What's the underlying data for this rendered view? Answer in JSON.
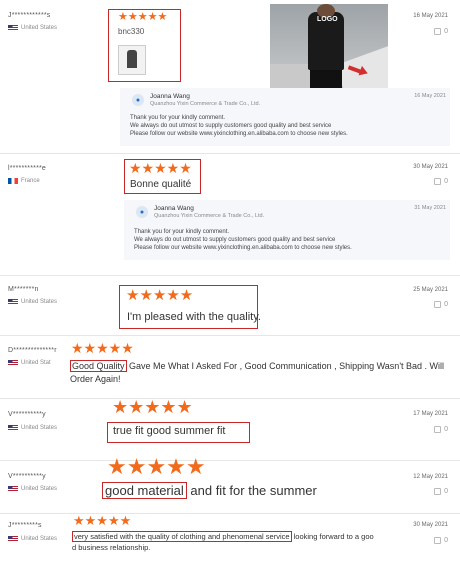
{
  "reviews": [
    {
      "user": "J************s",
      "country": "United States",
      "flag": "us",
      "date": "16 May 2021",
      "likes": "0",
      "stars": "★★★★★",
      "text": "bnc330",
      "reply": {
        "name": "Joanna Wang",
        "company": "Quanzhou Yixin Commerce & Trade Co., Ltd.",
        "date": "16 May 2021",
        "line1": "Thank you for your kindly comment.",
        "line2": "We always do out utmost to supply customers good quality and best service",
        "line3": "Please follow our website  www.yixinclothing.en.alibaba.com to choose new styles."
      },
      "photo_logo": "LOGO"
    },
    {
      "user": "l***********e",
      "country": "France",
      "flag": "fr",
      "date": "30 May 2021",
      "likes": "0",
      "stars": "★★★★★",
      "text": "Bonne qualité",
      "reply": {
        "name": "Joanna Wang",
        "company": "Quanzhou Yixin Commerce & Trade Co., Ltd.",
        "date": "31 May 2021",
        "line1": "Thank you for your kindly comment.",
        "line2": "We always do out utmost to supply customers good quality and best service",
        "line3": "Please follow our website  www.yixinclothing.en.alibaba.com to choose new styles."
      }
    },
    {
      "user": "M*******n",
      "country": "United States",
      "flag": "us",
      "date": "25 May 2021",
      "likes": "0",
      "stars": "★★★★★",
      "text": "I'm pleased with the quality."
    },
    {
      "user": "D**************r",
      "country": "United Stat",
      "flag": "us",
      "stars": "★★★★★",
      "text_box": "Good Quality",
      "text_rest": " Gave Me What I Asked For , Good Communication , Shipping Wasn't Bad . Will",
      "text_line2": "Order Again!"
    },
    {
      "user": "V**********y",
      "country": "United States",
      "flag": "us",
      "date": "17 May 2021",
      "likes": "0",
      "stars": "★★★★★",
      "text": "true fit good summer fit"
    },
    {
      "user": "V**********y",
      "country": "United States",
      "flag": "us",
      "date": "12 May 2021",
      "likes": "0",
      "stars": "★★★★★",
      "text_box": "good material",
      "text_rest": " and fit for the summer"
    },
    {
      "user": "J*********s",
      "country": "United States",
      "flag": "us",
      "date": "30 May 2021",
      "likes": "0",
      "stars": "★★★★★",
      "text_box": "very satisfied with the quality of clothing and phenomenal service",
      "text_rest": " looking forward to a goo",
      "text_line2": "d business relationship."
    }
  ]
}
